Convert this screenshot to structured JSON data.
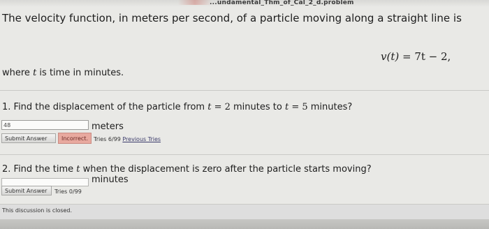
{
  "header": {
    "filename": "...undamental_Thm_of_Cal_2_d.problem"
  },
  "problem": {
    "intro": "The velocity function, in meters per second, of a particle moving along a straight line is",
    "formula_lhs": "v(t)",
    "formula_eq": " = 7t − 2,",
    "where_pre": "where ",
    "where_var": "t",
    "where_post": " is time in minutes."
  },
  "question1": {
    "pre": "1. Find the displacement of the particle from ",
    "v1": "t",
    "eq1": " = 2",
    "mid": " minutes to ",
    "v2": "t",
    "eq2": " = 5",
    "post": " minutes?",
    "answer_value": "48",
    "units": "meters",
    "submit_label": "Submit Answer",
    "status": "Incorrect.",
    "tries": "Tries 6/99",
    "previous_tries": "Previous Tries"
  },
  "question2": {
    "pre": "2. Find the time ",
    "var": "t",
    "post": " when the displacement is zero after the particle starts moving?",
    "answer_value": "",
    "units": "minutes",
    "submit_label": "Submit Answer",
    "tries": "Tries 0/99"
  },
  "footer": {
    "closed_text": "This discussion is closed."
  },
  "colors": {
    "incorrect_bg": "#e8a99f",
    "page_bg": "#e9e9e6"
  }
}
